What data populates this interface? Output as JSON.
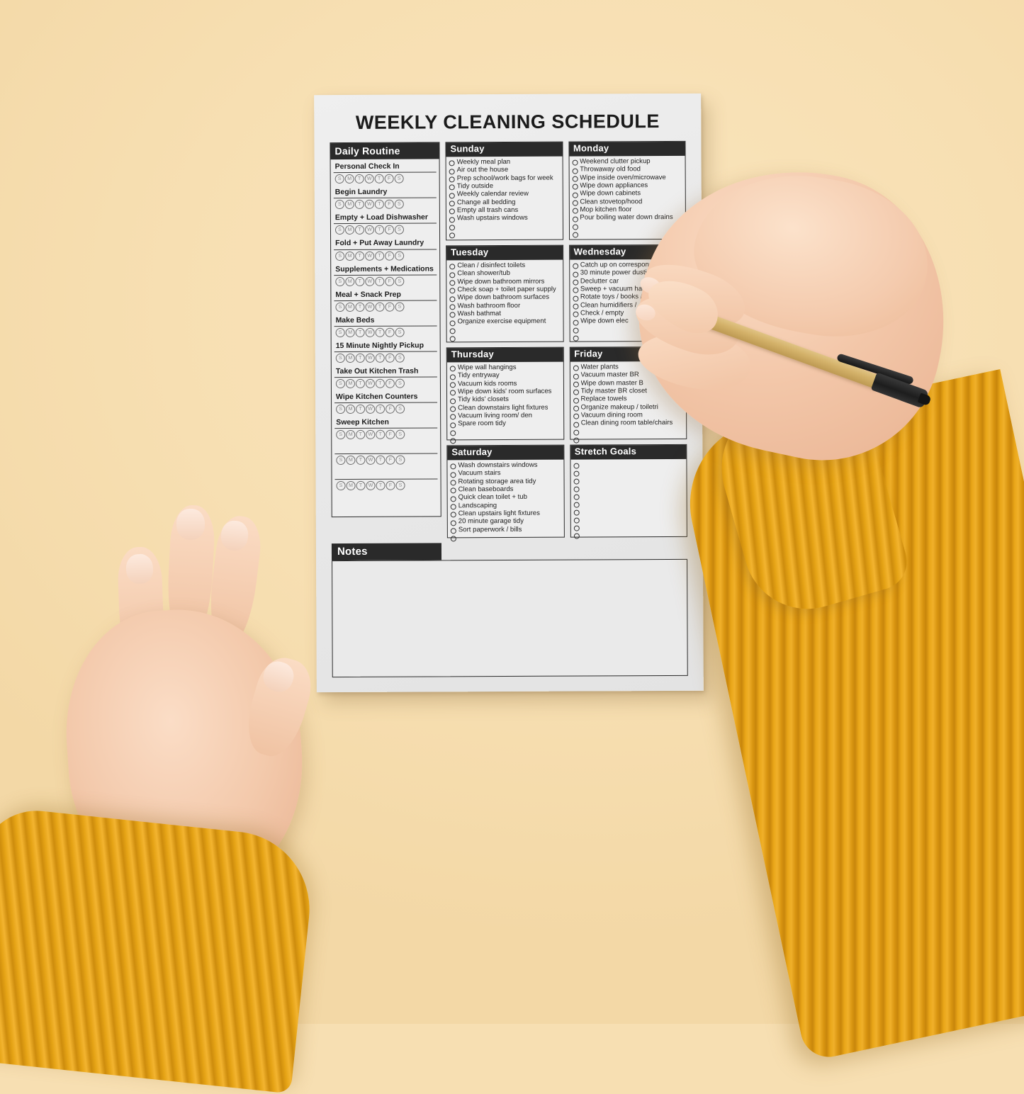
{
  "document": {
    "title": "WEEKLY CLEANING SCHEDULE"
  },
  "daily_routine": {
    "heading": "Daily Routine",
    "day_letters": [
      "S",
      "M",
      "T",
      "W",
      "T",
      "F",
      "S"
    ],
    "items": [
      "Personal Check In",
      "Begin Laundry",
      "Empty + Load Dishwasher",
      "Fold + Put Away Laundry",
      "Supplements + Medications",
      "Meal + Snack Prep",
      "Make Beds",
      "15 Minute Nightly Pickup",
      "Take Out Kitchen Trash",
      "Wipe Kitchen Counters",
      "Sweep Kitchen",
      "",
      ""
    ]
  },
  "days": [
    {
      "heading": "Sunday",
      "items": [
        "Weekly meal plan",
        "Air out the house",
        "Prep school/work bags for week",
        "Tidy outside",
        "Weekly calendar review",
        "Change all bedding",
        "Empty all trash cans",
        "Wash upstairs windows",
        "",
        ""
      ]
    },
    {
      "heading": "Monday",
      "items": [
        "Weekend clutter pickup",
        "Throwaway old food",
        "Wipe inside oven/microwave",
        "Wipe down appliances",
        "Wipe down cabinets",
        "Clean stovetop/hood",
        "Mop kitchen floor",
        "Pour boiling water down drains",
        "",
        ""
      ]
    },
    {
      "heading": "Tuesday",
      "items": [
        "Clean / disinfect toilets",
        "Clean shower/tub",
        "Wipe down bathroom mirrors",
        "Check soap + toilet paper supply",
        "Wipe down bathroom surfaces",
        "Wash bathroom floor",
        "Wash bathmat",
        "Organize exercise equipment",
        "",
        ""
      ]
    },
    {
      "heading": "Wednesday",
      "items": [
        "Catch up on correspondence",
        "30 minute power dusting",
        "Declutter car",
        "Sweep + vacuum hallways",
        "Rotate toys / books /",
        "Clean humidifiers /",
        "Check / empty",
        "Wipe down elec",
        "",
        ""
      ]
    },
    {
      "heading": "Thursday",
      "items": [
        "Wipe wall hangings",
        "Tidy entryway",
        "Vacuum kids rooms",
        "Wipe down kids' room surfaces",
        "Tidy kids' closets",
        "Clean downstairs light fixtures",
        "Vacuum living room/ den",
        "Spare room tidy",
        "",
        ""
      ]
    },
    {
      "heading": "Friday",
      "items": [
        "Water plants",
        "Vacuum master BR",
        "Wipe down master B",
        "Tidy master BR closet",
        "Replace towels",
        "Organize makeup / toiletri",
        "Vacuum dining room",
        "Clean dining room table/chairs",
        "",
        ""
      ]
    },
    {
      "heading": "Saturday",
      "items": [
        "Wash downstairs windows",
        "Vacuum stairs",
        "Rotating storage area tidy",
        "Clean baseboards",
        "Quick clean toilet + tub",
        "Landscaping",
        "Clean upstairs light fixtures",
        "20 minute garage tidy",
        "Sort paperwork / bills",
        ""
      ]
    },
    {
      "heading": "Stretch Goals",
      "items": [
        "",
        "",
        "",
        "",
        "",
        "",
        "",
        "",
        "",
        ""
      ]
    }
  ],
  "notes": {
    "heading": "Notes",
    "content": ""
  },
  "colors": {
    "background": "#F7DFB2",
    "paper": "#EBEBEB",
    "header_bar": "#2A2A2A",
    "sweater": "#E5A315",
    "skin": "#F3C9AB",
    "pen_body": "#D4B26A",
    "pen_cap": "#1D1D1D"
  }
}
